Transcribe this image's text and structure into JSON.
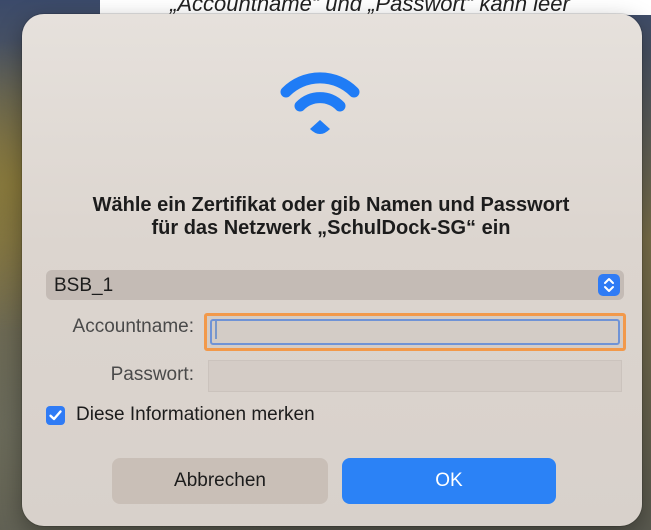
{
  "top_caption": "„Accountname“ und „Passwort“ kann leer",
  "dialog": {
    "icon": "wifi-icon",
    "title_line1": "Wähle ein Zertifikat oder gib Namen und Passwort",
    "title_line2": "für das Netzwerk „SchulDock-SG“ ein",
    "certificate_select": {
      "value": "BSB_1",
      "icon": "chevron-updown-icon"
    },
    "account_label": "Accountname:",
    "account_value": "",
    "password_label": "Passwort:",
    "password_value": "",
    "remember_checkbox": {
      "label": "Diese Informationen merken",
      "checked": true
    },
    "cancel_label": "Abbrechen",
    "ok_label": "OK"
  },
  "colors": {
    "accent": "#2b82f6",
    "focus_highlight": "#f2994a"
  }
}
